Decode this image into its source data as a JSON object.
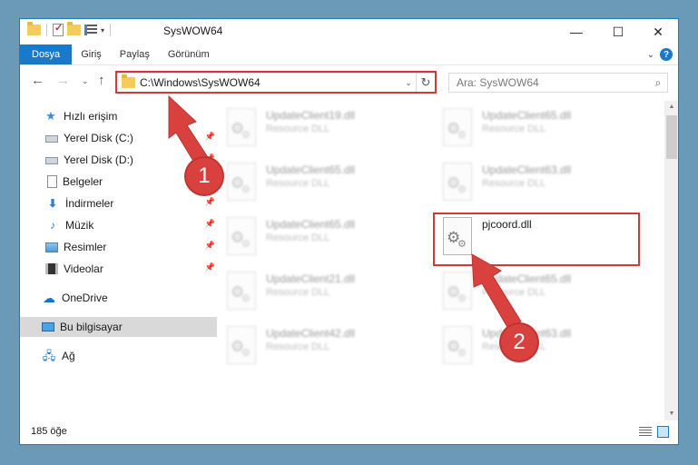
{
  "window": {
    "title": "SysWOW64",
    "controls": {
      "minimize": "—",
      "maximize": "☐",
      "close": "✕"
    }
  },
  "ribbon": {
    "tabs": [
      "Dosya",
      "Giriş",
      "Paylaş",
      "Görünüm"
    ],
    "help": "?"
  },
  "nav": {
    "address": "C:\\Windows\\SysWOW64",
    "search_placeholder": "Ara: SysWOW64"
  },
  "sidebar": {
    "items": [
      {
        "label": "Hızlı erişim",
        "icon": "star-icon"
      },
      {
        "label": "Yerel Disk (C:)",
        "icon": "disk-icon",
        "pinned": true
      },
      {
        "label": "Yerel Disk (D:)",
        "icon": "disk-icon",
        "pinned": true
      },
      {
        "label": "Belgeler",
        "icon": "document-icon",
        "pinned": true
      },
      {
        "label": "İndirmeler",
        "icon": "download-icon",
        "pinned": true
      },
      {
        "label": "Müzik",
        "icon": "music-icon",
        "pinned": true
      },
      {
        "label": "Resimler",
        "icon": "picture-icon",
        "pinned": true
      },
      {
        "label": "Videolar",
        "icon": "video-icon",
        "pinned": true
      },
      {
        "label": "OneDrive",
        "icon": "cloud-icon"
      },
      {
        "label": "Bu bilgisayar",
        "icon": "computer-icon",
        "selected": true
      },
      {
        "label": "Ağ",
        "icon": "network-icon"
      }
    ]
  },
  "files": [
    {
      "name": "UpdateClient19.dll",
      "type": "Resource DLL"
    },
    {
      "name": "UpdateClient65.dll",
      "type": "Resource DLL"
    },
    {
      "name": "UpdateClient65.dll",
      "type": "Resource DLL"
    },
    {
      "name": "UpdateClient63.dll",
      "type": "Resource DLL"
    },
    {
      "name": "UpdateClient65.dll",
      "type": "Resource DLL"
    },
    {
      "name": "pjcoord.dll",
      "type": ""
    },
    {
      "name": "UpdateClient21.dll",
      "type": "Resource DLL"
    },
    {
      "name": "UpdateClient65.dll",
      "type": "Resource DLL"
    },
    {
      "name": "UpdateClient42.dll",
      "type": "Resource DLL"
    },
    {
      "name": "UpdateClient63.dll",
      "type": "Resource DLL"
    }
  ],
  "status": {
    "count": "185 öğe"
  },
  "annotations": {
    "step1": "1",
    "step2": "2",
    "color": "#d23a3a"
  }
}
